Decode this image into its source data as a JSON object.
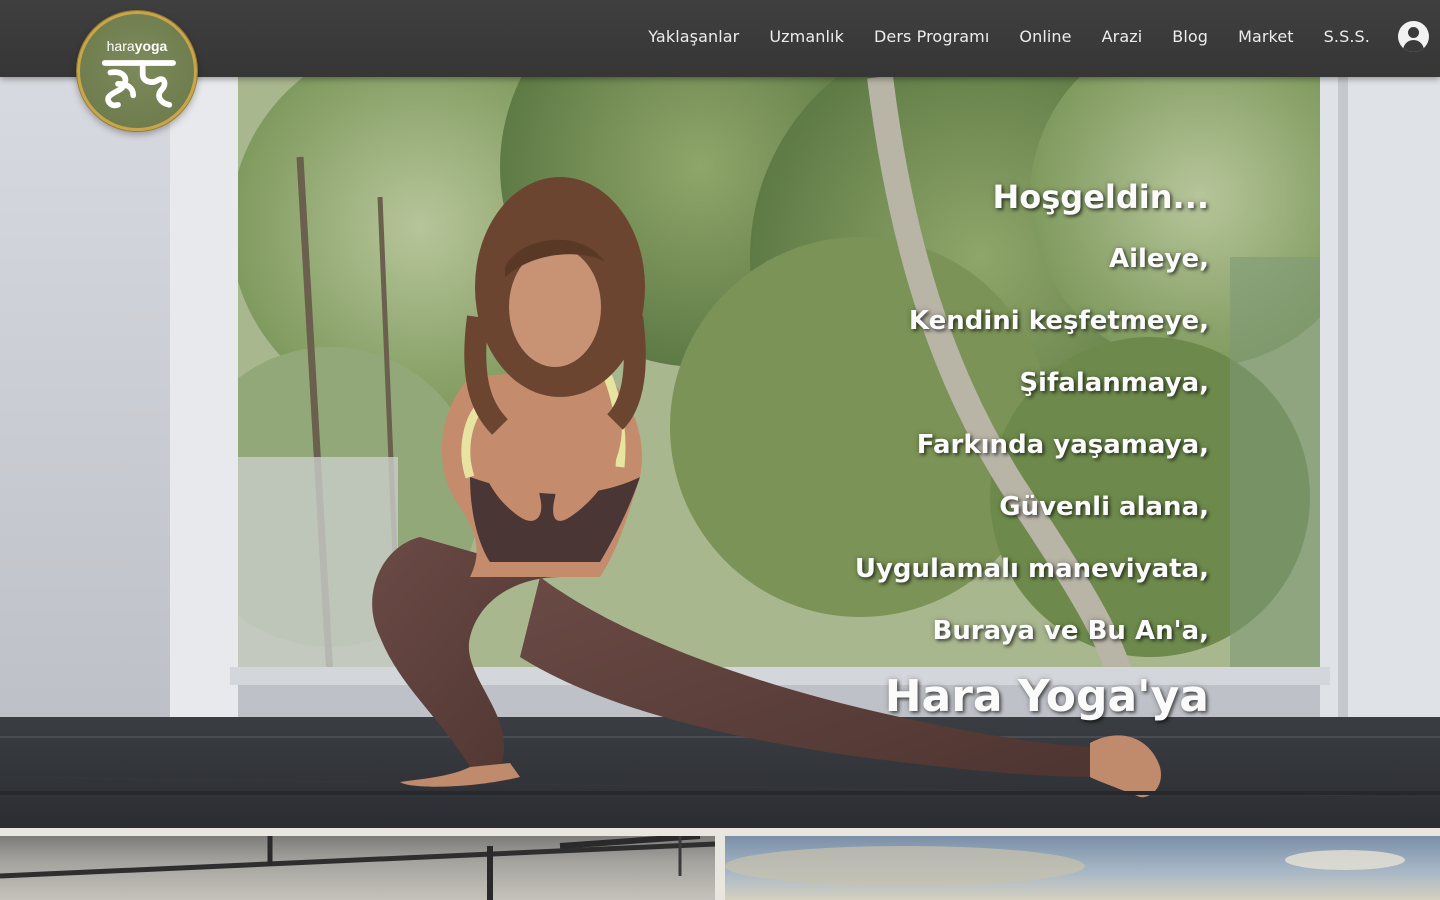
{
  "logo": {
    "text_light": "hara",
    "text_bold": "yoga",
    "glyph": "हर"
  },
  "nav": [
    {
      "label": "Yaklaşanlar"
    },
    {
      "label": "Uzmanlık"
    },
    {
      "label": "Ders Programı"
    },
    {
      "label": "Online"
    },
    {
      "label": "Arazi"
    },
    {
      "label": "Blog"
    },
    {
      "label": "Market"
    },
    {
      "label": "S.S.S."
    }
  ],
  "account_icon": "user-avatar-icon",
  "hero": {
    "title": "Hoşgeldin...",
    "lines": [
      "Aileye,",
      "Kendini keşfetmeye,",
      "Şifalanmaya,",
      "Farkında yaşamaya,",
      "Güvenli alana,",
      "Uygulamalı maneviyata,",
      "Buraya ve Bu An'a,"
    ],
    "brand": "Hara Yoga'ya"
  },
  "colors": {
    "header": "#3a3a3a",
    "logo_green": "#6f7d4f",
    "logo_gold": "#c9a54a",
    "text": "#ffffff"
  }
}
